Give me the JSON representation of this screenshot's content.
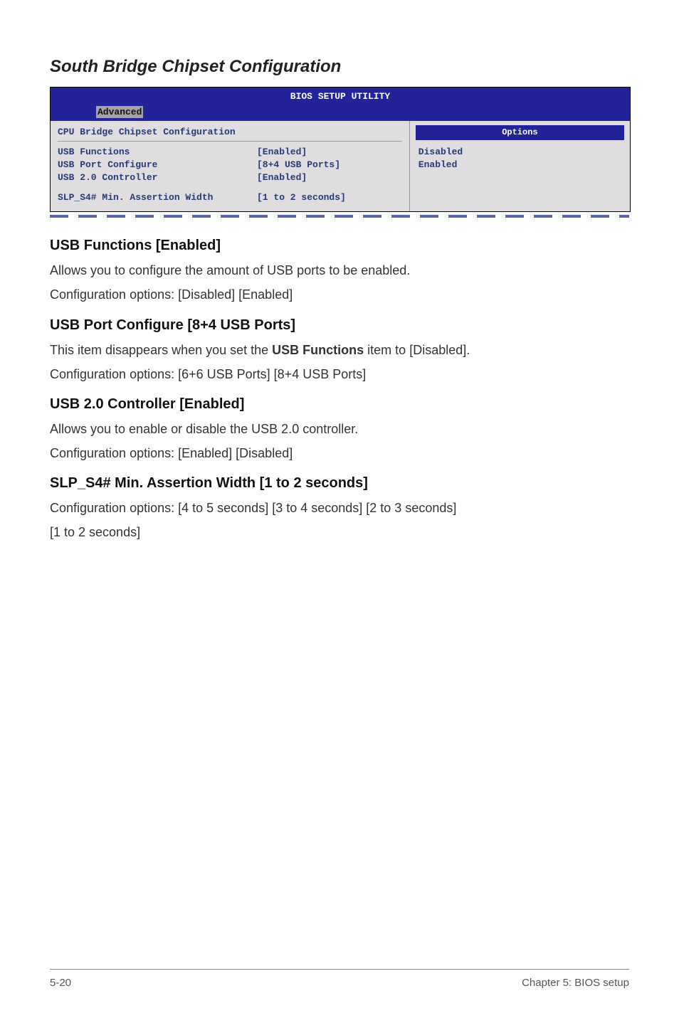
{
  "heading": "South Bridge Chipset Configuration",
  "bios": {
    "title": "BIOS SETUP UTILITY",
    "tab_active": "Advanced",
    "panel_title": "CPU Bridge Chipset Configuration",
    "rows": [
      {
        "label": "USB Functions",
        "value": "[Enabled]"
      },
      {
        "label": "USB Port Configure",
        "value": "[8+4 USB Ports]"
      },
      {
        "label": "USB 2.0 Controller",
        "value": "[Enabled]"
      },
      {
        "label": "SLP_S4# Min. Assertion Width",
        "value": "[1 to 2 seconds]"
      }
    ],
    "options_header": "Options",
    "options": [
      "Disabled",
      "Enabled"
    ]
  },
  "sections": [
    {
      "heading": "USB Functions [Enabled]",
      "lines": [
        "Allows you to configure the amount of USB ports to be enabled.",
        "Configuration options: [Disabled] [Enabled]"
      ]
    },
    {
      "heading": "USB Port Configure [8+4 USB Ports]",
      "lines_rich": [
        [
          {
            "t": "This item disappears when you set the "
          },
          {
            "t": "USB Functions",
            "bold": true
          },
          {
            "t": " item to [Disabled]."
          }
        ],
        [
          {
            "t": "Configuration options: [6+6 USB Ports] [8+4 USB Ports]"
          }
        ]
      ]
    },
    {
      "heading": "USB 2.0 Controller [Enabled]",
      "lines": [
        "Allows you to enable or disable the USB 2.0 controller.",
        "Configuration options: [Enabled] [Disabled]"
      ]
    },
    {
      "heading": "SLP_S4# Min. Assertion Width [1 to 2 seconds]",
      "lines": [
        "Configuration options: [4 to 5 seconds] [3 to 4 seconds] [2 to 3 seconds]",
        "[1 to 2 seconds]"
      ]
    }
  ],
  "footer": {
    "left": "5-20",
    "right": "Chapter 5: BIOS setup"
  }
}
